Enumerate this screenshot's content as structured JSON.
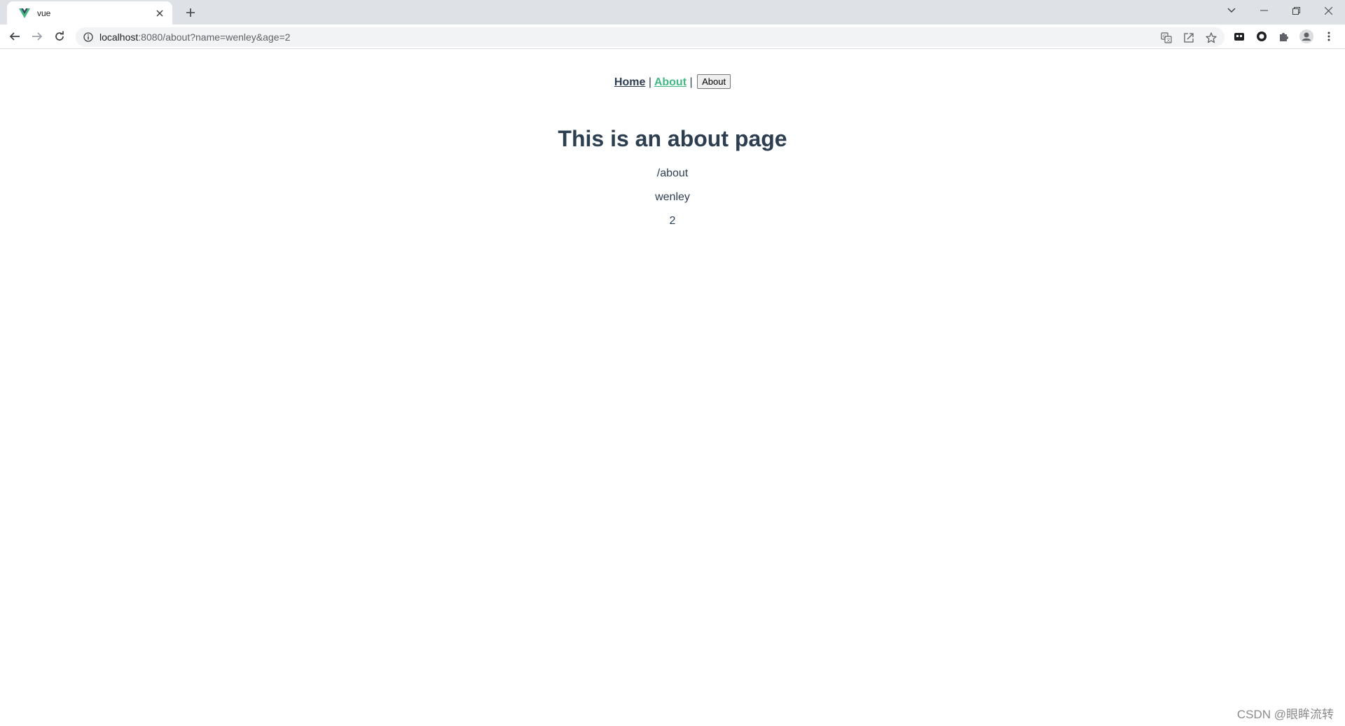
{
  "browser": {
    "tab_title": "vue",
    "url_host": "localhost",
    "url_rest": ":8080/about?name=wenley&age=2",
    "icons": [
      "vue-favicon-icon",
      "close-icon",
      "plus-icon",
      "chevron-down-icon",
      "minimize-icon",
      "restore-icon",
      "window-close-icon",
      "back-arrow-icon",
      "forward-arrow-icon",
      "reload-icon",
      "info-icon",
      "translate-icon",
      "share-icon",
      "star-icon",
      "extension-square-icon",
      "extension-circle-icon",
      "puzzle-icon",
      "profile-icon",
      "kebab-menu-icon"
    ],
    "colors": {
      "tabstrip_bg": "#dee1e6",
      "omnibox_bg": "#f1f3f4",
      "vue_green": "#42b983",
      "text_dark": "#2c3e50"
    }
  },
  "nav": {
    "home_label": "Home",
    "separator_1": "|",
    "about_label": "About",
    "separator_2": "|",
    "about_button_label": "About"
  },
  "page": {
    "heading": "This is an about page",
    "route_path": "/about",
    "query_name": "wenley",
    "query_age": "2"
  },
  "watermark": "CSDN @眼眸流转"
}
